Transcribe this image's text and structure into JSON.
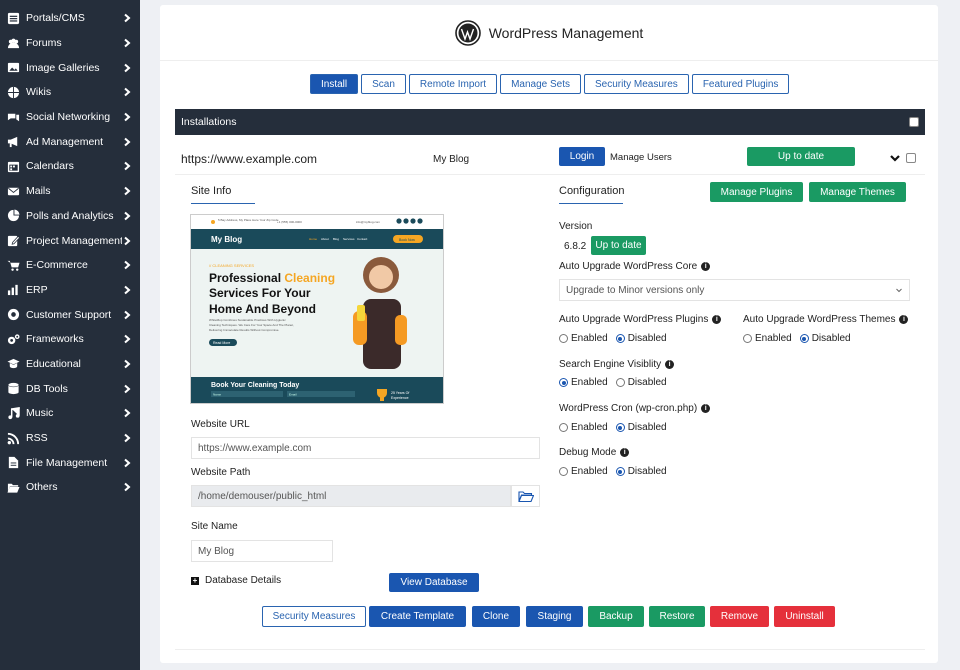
{
  "sidebar": {
    "items": [
      {
        "label": "Portals/CMS",
        "icon": "list-icon"
      },
      {
        "label": "Forums",
        "icon": "users-icon"
      },
      {
        "label": "Image Galleries",
        "icon": "image-icon"
      },
      {
        "label": "Wikis",
        "icon": "globe-icon"
      },
      {
        "label": "Social Networking",
        "icon": "comments-icon"
      },
      {
        "label": "Ad Management",
        "icon": "megaphone-icon"
      },
      {
        "label": "Calendars",
        "icon": "calendar-icon"
      },
      {
        "label": "Mails",
        "icon": "envelope-icon"
      },
      {
        "label": "Polls and Analytics",
        "icon": "pie-chart-icon"
      },
      {
        "label": "Project Management",
        "icon": "edit-icon"
      },
      {
        "label": "E-Commerce",
        "icon": "cart-icon"
      },
      {
        "label": "ERP",
        "icon": "chart-icon"
      },
      {
        "label": "Customer Support",
        "icon": "lifebuoy-icon"
      },
      {
        "label": "Frameworks",
        "icon": "cogs-icon"
      },
      {
        "label": "Educational",
        "icon": "graduation-cap-icon"
      },
      {
        "label": "DB Tools",
        "icon": "database-icon"
      },
      {
        "label": "Music",
        "icon": "music-icon"
      },
      {
        "label": "RSS",
        "icon": "rss-icon"
      },
      {
        "label": "File Management",
        "icon": "file-icon"
      },
      {
        "label": "Others",
        "icon": "folder-open-icon"
      }
    ]
  },
  "header": {
    "title": "WordPress Management"
  },
  "tabs": [
    "Install",
    "Scan",
    "Remote Import",
    "Manage Sets",
    "Security Measures",
    "Featured Plugins"
  ],
  "installations": {
    "title": "Installations",
    "url": "https://www.example.com",
    "name": "My Blog",
    "login": "Login",
    "manage_users": "Manage Users",
    "status": "Up to date"
  },
  "site_info": {
    "title": "Site Info",
    "website_url_label": "Website URL",
    "website_url_placeholder": "https://www.example.com",
    "website_path_label": "Website Path",
    "website_path_value": "/home/demouser/public_html",
    "site_name_label": "Site Name",
    "site_name_value": "My Blog",
    "db_details_label": "Database Details",
    "view_db": "View Database"
  },
  "thumbnail": {
    "contact_left": "5 Bay Address, My Place Here Your Zip Code",
    "contact_phone": "+1 (555) 000-0000",
    "contact_email": "info@myblog.com",
    "logo": "My Blog",
    "nav": [
      "Home",
      "About",
      "Blog",
      "Services",
      "Contact"
    ],
    "cta": "Book Now",
    "kicker": "// CLEANING SERVICES",
    "headline_1": "Professional",
    "headline_highlight": "Cleaning",
    "headline_2": "Services For Your",
    "headline_3": "Home And Beyond",
    "body": "WhiteMop Combines Sustainable Practices With Hygienic Cleaning Techniques. We Care For Your Space And The Planet, Delivering Immaculate Results Without Compromise.",
    "read_more": "Read More",
    "book_title": "Book Your Cleaning Today",
    "form_name": "Name",
    "form_email": "Email",
    "years_1": "25 Years Of",
    "years_2": "Experience"
  },
  "configuration": {
    "title": "Configuration",
    "manage_plugins": "Manage Plugins",
    "manage_themes": "Manage Themes",
    "version_label": "Version",
    "version_value": "6.8.2",
    "version_status": "Up to date",
    "core_label": "Auto Upgrade WordPress Core",
    "core_value": "Upgrade to Minor versions only",
    "plugins_label": "Auto Upgrade WordPress Plugins",
    "themes_label": "Auto Upgrade WordPress Themes",
    "seo_label": "Search Engine Visiblity",
    "cron_label": "WordPress Cron (wp-cron.php)",
    "debug_label": "Debug Mode",
    "enabled": "Enabled",
    "disabled": "Disabled"
  },
  "actions": [
    "Security Measures",
    "Create Template",
    "Clone",
    "Staging",
    "Backup",
    "Restore",
    "Remove",
    "Uninstall"
  ],
  "colors": {
    "primary": "#1a56b0",
    "success": "#1a9a63",
    "danger": "#e5303b",
    "sidebar": "#252e3b",
    "accent": "#f5a623"
  }
}
